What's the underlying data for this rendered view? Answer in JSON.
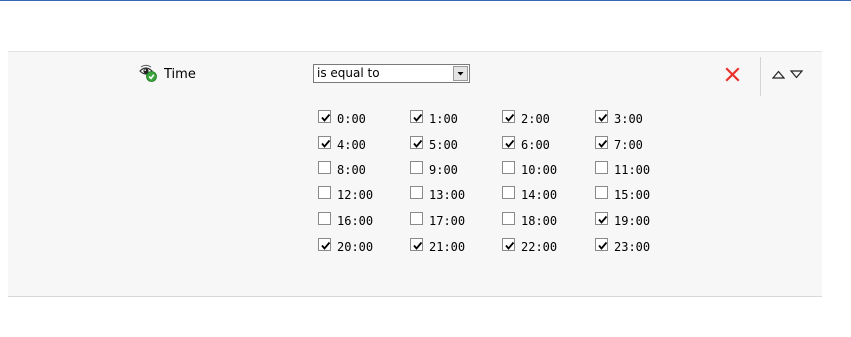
{
  "rule": {
    "name": "Time",
    "icon": "visibility-check-icon"
  },
  "operator": {
    "selected": "is equal to"
  },
  "actions": {
    "remove_icon": "close-x-icon",
    "move_up_icon": "triangle-up-icon",
    "move_down_icon": "triangle-down-icon"
  },
  "hours": [
    {
      "label": "0:00",
      "checked": true
    },
    {
      "label": "1:00",
      "checked": true
    },
    {
      "label": "2:00",
      "checked": true
    },
    {
      "label": "3:00",
      "checked": true
    },
    {
      "label": "4:00",
      "checked": true
    },
    {
      "label": "5:00",
      "checked": true
    },
    {
      "label": "6:00",
      "checked": true
    },
    {
      "label": "7:00",
      "checked": true
    },
    {
      "label": "8:00",
      "checked": false
    },
    {
      "label": "9:00",
      "checked": false
    },
    {
      "label": "10:00",
      "checked": false
    },
    {
      "label": "11:00",
      "checked": false
    },
    {
      "label": "12:00",
      "checked": false
    },
    {
      "label": "13:00",
      "checked": false
    },
    {
      "label": "14:00",
      "checked": false
    },
    {
      "label": "15:00",
      "checked": false
    },
    {
      "label": "16:00",
      "checked": false
    },
    {
      "label": "17:00",
      "checked": false
    },
    {
      "label": "18:00",
      "checked": false
    },
    {
      "label": "19:00",
      "checked": true
    },
    {
      "label": "20:00",
      "checked": true
    },
    {
      "label": "21:00",
      "checked": true
    },
    {
      "label": "22:00",
      "checked": true
    },
    {
      "label": "23:00",
      "checked": true
    }
  ],
  "colors": {
    "accent_rule": "#3a64b4",
    "remove": "#e8322a",
    "panel_background": "#f7f7f7"
  }
}
